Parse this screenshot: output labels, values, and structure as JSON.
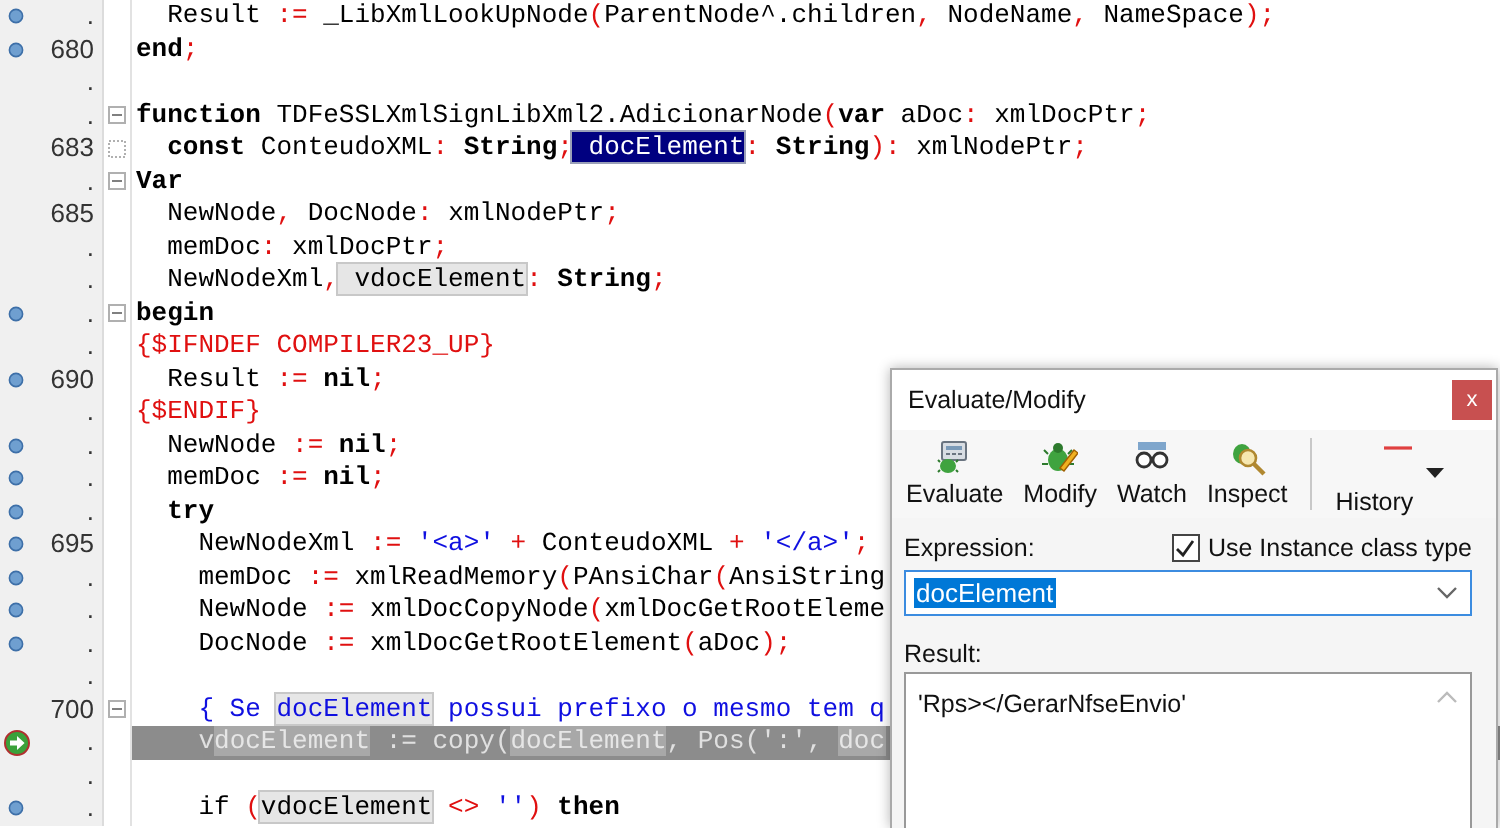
{
  "editor": {
    "lines": [
      {
        "gutter": ".",
        "compiled": true,
        "execution_point": false,
        "collapsible": false,
        "continuation": false,
        "current": false,
        "tokens": [
          {
            "text": "  Result ",
            "kind": "id"
          },
          {
            "text": ":=",
            "kind": "sym"
          },
          {
            "text": " _LibXmlLookUpNode",
            "kind": "id"
          },
          {
            "text": "(",
            "kind": "sym"
          },
          {
            "text": "ParentNode^.children",
            "kind": "id"
          },
          {
            "text": ",",
            "kind": "sym"
          },
          {
            "text": " NodeName",
            "kind": "id"
          },
          {
            "text": ",",
            "kind": "sym"
          },
          {
            "text": " NameSpace",
            "kind": "id"
          },
          {
            "text": ");",
            "kind": "sym"
          }
        ]
      },
      {
        "gutter": "680",
        "compiled": true,
        "execution_point": false,
        "collapsible": false,
        "continuation": false,
        "current": false,
        "tokens": [
          {
            "text": "end",
            "kind": "kw"
          },
          {
            "text": ";",
            "kind": "sym"
          }
        ]
      },
      {
        "gutter": ".",
        "compiled": false,
        "execution_point": false,
        "collapsible": false,
        "continuation": false,
        "current": false
      },
      {
        "gutter": ".",
        "compiled": false,
        "execution_point": false,
        "collapsible": true,
        "continuation": false,
        "current": false,
        "tokens": [
          {
            "text": "function",
            "kind": "kw"
          },
          {
            "text": " TDFeSSLXmlSignLibXml2.AdicionarNode",
            "kind": "id"
          },
          {
            "text": "(",
            "kind": "sym"
          },
          {
            "text": "var",
            "kind": "kw"
          },
          {
            "text": " aDoc",
            "kind": "id"
          },
          {
            "text": ":",
            "kind": "sym"
          },
          {
            "text": " xmlDocPtr",
            "kind": "id"
          },
          {
            "text": ";",
            "kind": "sym"
          }
        ]
      },
      {
        "gutter": "683",
        "compiled": false,
        "execution_point": false,
        "collapsible": false,
        "continuation": true,
        "current": false,
        "tokens": [
          {
            "text": "  const",
            "kind": "kw"
          },
          {
            "text": " ConteudoXML",
            "kind": "id"
          },
          {
            "text": ":",
            "kind": "sym"
          },
          {
            "text": " String",
            "kind": "kw"
          },
          {
            "text": ";",
            "kind": "sym"
          },
          {
            "text": " docElement",
            "kind": "sel"
          },
          {
            "text": ":",
            "kind": "sym"
          },
          {
            "text": " String",
            "kind": "kw"
          },
          {
            "text": "):",
            "kind": "sym"
          },
          {
            "text": " xmlNodePtr",
            "kind": "id"
          },
          {
            "text": ";",
            "kind": "sym"
          }
        ]
      },
      {
        "gutter": ".",
        "compiled": false,
        "execution_point": false,
        "collapsible": true,
        "continuation": false,
        "current": false,
        "tokens": [
          {
            "text": "Var",
            "kind": "kw"
          }
        ]
      },
      {
        "gutter": "685",
        "compiled": false,
        "execution_point": false,
        "collapsible": false,
        "continuation": false,
        "current": false,
        "tokens": [
          {
            "text": "  NewNode",
            "kind": "id"
          },
          {
            "text": ",",
            "kind": "sym"
          },
          {
            "text": " DocNode",
            "kind": "id"
          },
          {
            "text": ":",
            "kind": "sym"
          },
          {
            "text": " xmlNodePtr",
            "kind": "id"
          },
          {
            "text": ";",
            "kind": "sym"
          }
        ]
      },
      {
        "gutter": ".",
        "compiled": false,
        "execution_point": false,
        "collapsible": false,
        "continuation": false,
        "current": false,
        "tokens": [
          {
            "text": "  memDoc",
            "kind": "id"
          },
          {
            "text": ":",
            "kind": "sym"
          },
          {
            "text": " xmlDocPtr",
            "kind": "id"
          },
          {
            "text": ";",
            "kind": "sym"
          }
        ]
      },
      {
        "gutter": ".",
        "compiled": false,
        "execution_point": false,
        "collapsible": false,
        "continuation": false,
        "current": false,
        "tokens": [
          {
            "text": "  NewNodeXml",
            "kind": "id"
          },
          {
            "text": ",",
            "kind": "sym"
          },
          {
            "text": " vdocElement",
            "kind": "ref"
          },
          {
            "text": ":",
            "kind": "sym"
          },
          {
            "text": " String",
            "kind": "kw"
          },
          {
            "text": ";",
            "kind": "sym"
          }
        ]
      },
      {
        "gutter": ".",
        "compiled": true,
        "execution_point": false,
        "collapsible": true,
        "continuation": false,
        "current": false,
        "tokens": [
          {
            "text": "begin",
            "kind": "kw"
          }
        ]
      },
      {
        "gutter": ".",
        "compiled": false,
        "execution_point": false,
        "collapsible": false,
        "continuation": false,
        "current": false,
        "tokens": [
          {
            "text": "{$IFNDEF COMPILER23_UP}",
            "kind": "dir"
          }
        ]
      },
      {
        "gutter": "690",
        "compiled": true,
        "execution_point": false,
        "collapsible": false,
        "continuation": false,
        "current": false,
        "tokens": [
          {
            "text": "  Result ",
            "kind": "id"
          },
          {
            "text": ":=",
            "kind": "sym"
          },
          {
            "text": " nil",
            "kind": "kw"
          },
          {
            "text": ";",
            "kind": "sym"
          }
        ]
      },
      {
        "gutter": ".",
        "compiled": false,
        "execution_point": false,
        "collapsible": false,
        "continuation": false,
        "current": false,
        "tokens": [
          {
            "text": "{$ENDIF}",
            "kind": "dir"
          }
        ]
      },
      {
        "gutter": ".",
        "compiled": true,
        "execution_point": false,
        "collapsible": false,
        "continuation": false,
        "current": false,
        "tokens": [
          {
            "text": "  NewNode ",
            "kind": "id"
          },
          {
            "text": ":=",
            "kind": "sym"
          },
          {
            "text": " nil",
            "kind": "kw"
          },
          {
            "text": ";",
            "kind": "sym"
          }
        ]
      },
      {
        "gutter": ".",
        "compiled": true,
        "execution_point": false,
        "collapsible": false,
        "continuation": false,
        "current": false,
        "tokens": [
          {
            "text": "  memDoc ",
            "kind": "id"
          },
          {
            "text": ":=",
            "kind": "sym"
          },
          {
            "text": " nil",
            "kind": "kw"
          },
          {
            "text": ";",
            "kind": "sym"
          }
        ]
      },
      {
        "gutter": ".",
        "compiled": true,
        "execution_point": false,
        "collapsible": false,
        "continuation": false,
        "current": false,
        "tokens": [
          {
            "text": "  try",
            "kind": "kw"
          }
        ]
      },
      {
        "gutter": "695",
        "compiled": true,
        "execution_point": false,
        "collapsible": false,
        "continuation": false,
        "current": false,
        "tokens": [
          {
            "text": "    NewNodeXml ",
            "kind": "id"
          },
          {
            "text": ":=",
            "kind": "sym"
          },
          {
            "text": " '<a>'",
            "kind": "str"
          },
          {
            "text": " +",
            "kind": "sym"
          },
          {
            "text": " ConteudoXML ",
            "kind": "id"
          },
          {
            "text": "+",
            "kind": "sym"
          },
          {
            "text": " '</a>'",
            "kind": "str"
          },
          {
            "text": ";",
            "kind": "sym"
          }
        ]
      },
      {
        "gutter": ".",
        "compiled": true,
        "execution_point": false,
        "collapsible": false,
        "continuation": false,
        "current": false,
        "tokens": [
          {
            "text": "    memDoc ",
            "kind": "id"
          },
          {
            "text": ":=",
            "kind": "sym"
          },
          {
            "text": " xmlReadMemory",
            "kind": "id"
          },
          {
            "text": "(",
            "kind": "sym"
          },
          {
            "text": "PAnsiChar",
            "kind": "id"
          },
          {
            "text": "(",
            "kind": "sym"
          },
          {
            "text": "AnsiString",
            "kind": "id"
          }
        ]
      },
      {
        "gutter": ".",
        "compiled": true,
        "execution_point": false,
        "collapsible": false,
        "continuation": false,
        "current": false,
        "tokens": [
          {
            "text": "    NewNode ",
            "kind": "id"
          },
          {
            "text": ":=",
            "kind": "sym"
          },
          {
            "text": " xmlDocCopyNode",
            "kind": "id"
          },
          {
            "text": "(",
            "kind": "sym"
          },
          {
            "text": "xmlDocGetRootEleme",
            "kind": "id"
          }
        ]
      },
      {
        "gutter": ".",
        "compiled": true,
        "execution_point": false,
        "collapsible": false,
        "continuation": false,
        "current": false,
        "tokens": [
          {
            "text": "    DocNode ",
            "kind": "id"
          },
          {
            "text": ":=",
            "kind": "sym"
          },
          {
            "text": " xmlDocGetRootElement",
            "kind": "id"
          },
          {
            "text": "(",
            "kind": "sym"
          },
          {
            "text": "aDoc",
            "kind": "id"
          },
          {
            "text": ");",
            "kind": "sym"
          }
        ]
      },
      {
        "gutter": ".",
        "compiled": false,
        "execution_point": false,
        "collapsible": false,
        "continuation": false,
        "current": false
      },
      {
        "gutter": "700",
        "compiled": false,
        "execution_point": false,
        "collapsible": true,
        "continuation": false,
        "current": false,
        "tokens": [
          {
            "text": "    { Se ",
            "kind": "cmt"
          },
          {
            "text": "docElement",
            "kind": "cmtref"
          },
          {
            "text": " possui prefixo o mesmo tem q",
            "kind": "cmt"
          }
        ]
      },
      {
        "gutter": ".",
        "compiled": false,
        "execution_point": true,
        "collapsible": false,
        "continuation": false,
        "current": true,
        "tokens": [
          {
            "text": "    v",
            "kind": "id"
          },
          {
            "text": "docElement",
            "kind": "ref"
          },
          {
            "text": " := copy(",
            "kind": "id"
          },
          {
            "text": "docElement",
            "kind": "ref"
          },
          {
            "text": ", Pos(':', ",
            "kind": "id"
          },
          {
            "text": "doc",
            "kind": "ref"
          }
        ]
      },
      {
        "gutter": ".",
        "compiled": false,
        "execution_point": false,
        "collapsible": false,
        "continuation": false,
        "current": false
      },
      {
        "gutter": ".",
        "compiled": true,
        "execution_point": false,
        "collapsible": false,
        "continuation": false,
        "current": false,
        "tokens": [
          {
            "text": "    if ",
            "kind": "id"
          },
          {
            "text": "(",
            "kind": "sym"
          },
          {
            "text": "vdocElement",
            "kind": "ref"
          },
          {
            "text": " <>",
            "kind": "sym"
          },
          {
            "text": " ''",
            "kind": "str"
          },
          {
            "text": ")",
            "kind": "sym"
          },
          {
            "text": " then",
            "kind": "kw"
          }
        ]
      }
    ]
  },
  "dialog": {
    "title": "Evaluate/Modify",
    "close": "x",
    "toolbar": [
      {
        "label": "Evaluate",
        "kind": "button"
      },
      {
        "label": "Modify",
        "kind": "button"
      },
      {
        "label": "Watch",
        "kind": "button"
      },
      {
        "label": "Inspect",
        "kind": "button"
      },
      {
        "label": "History",
        "kind": "dropdown"
      }
    ],
    "expression_label": "Expression:",
    "instance_checkbox": {
      "label": "Use Instance class type",
      "checked": true
    },
    "expression": {
      "value": "docElement",
      "text_selected": true
    },
    "result_label": "Result:",
    "result": "'Rps></GerarNfseEnvio'"
  }
}
